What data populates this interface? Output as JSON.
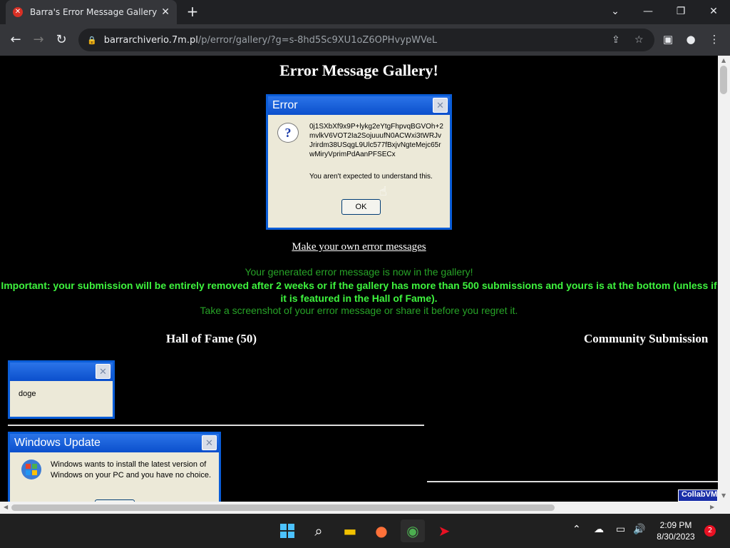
{
  "browser": {
    "tab_title": "Barra's Error Message Gallery",
    "url_host": "barrarchiverio.7m.pl",
    "url_path": "/p/error/gallery/?g=s-8hd5Sc9XU1oZ6OPHvypWVeL"
  },
  "page": {
    "heading": "Error Message Gallery!",
    "error_dialog": {
      "title": "Error",
      "text": "0j1SXbXf9x9P+lykg2eYtgFhpvqBGVOh+2mvlkV6VOT2Ia2SojuuufN0ACWxi3tWRJvJrirdm38USqgL9Ulc577fBxjvNgteMejc65rwMiryVprimPdAanPFSECx",
      "note": "You aren't expected to understand this.",
      "ok_label": "OK"
    },
    "make_own_link": "Make your own error messages",
    "message_1": "Your generated error message is now in the gallery!",
    "message_2": "Important: your submission will be entirely removed after 2 weeks or if the gallery has more than 500 submissions and yours is at the bottom (unless if it is featured in the Hall of Fame).",
    "message_3": "Take a screenshot of your error message or share it before you regret it.",
    "hall_of_fame_heading": "Hall of Fame (50)",
    "community_heading": "Community Submission",
    "doge_text": "doge",
    "windows_update": {
      "title": "Windows Update",
      "text": "Windows wants to install the latest version of Windows on your PC and you have no choice."
    },
    "collab_badge": "CollabVM"
  },
  "taskbar": {
    "time": "2:09 PM",
    "date": "8/30/2023",
    "notification_count": "2"
  }
}
